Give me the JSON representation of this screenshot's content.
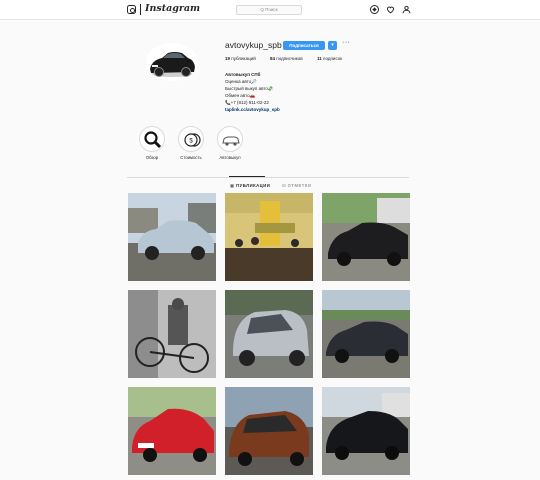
{
  "nav": {
    "logo_text": "Instagram",
    "search_placeholder": "Q Поиск"
  },
  "profile": {
    "username": "avtovykup_spb",
    "subscribe_label": "Подписаться",
    "dropdown_glyph": "▾",
    "more_glyph": "···",
    "stats": {
      "posts_count": "19",
      "posts_label": "публикаций",
      "followers_count": "84",
      "followers_label": "подписчиков",
      "following_count": "11",
      "following_label": "подписок"
    },
    "bio": {
      "name": "Автовыкуп СПб",
      "line1": "Оценка авто🔎",
      "line2": "Быстрый выкуп авто💸",
      "line3": "Обмен авто🚗",
      "line4": "📞+7 (812) 911-02-22",
      "link": "taplink.cc/avtovykup_spb"
    }
  },
  "highlights": [
    {
      "label": "Обзор",
      "icon": "magnifier-icon"
    },
    {
      "label": "Стоимость",
      "icon": "coins-icon"
    },
    {
      "label": "Автовыкуп",
      "icon": "car-icon"
    }
  ],
  "tabs": {
    "posts": "▦ ПУБЛИКАЦИИ",
    "tagged": "⊡ ОТМЕТКИ"
  },
  "colors": {
    "accent": "#3897f0",
    "link": "#003569"
  }
}
